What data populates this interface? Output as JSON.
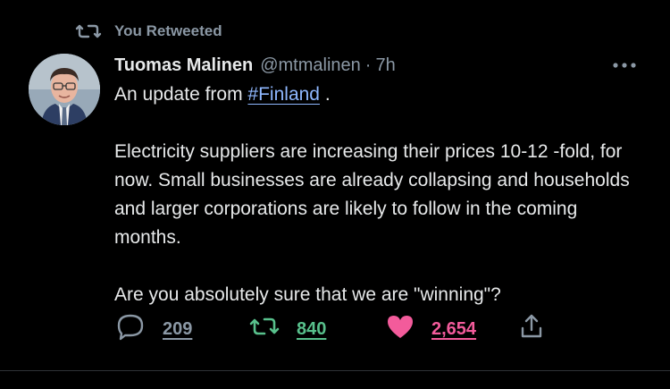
{
  "banner": {
    "text": "You Retweeted",
    "icon": "retweet-icon"
  },
  "author": {
    "display_name": "Tuomas Malinen",
    "handle": "@mtmalinen",
    "separator": "·",
    "time": "7h",
    "avatar_icon": "avatar-photo"
  },
  "menu": {
    "icon": "more-options-icon"
  },
  "tweet": {
    "line1_prefix": "An update from ",
    "hashtag": "#Finland",
    "line1_suffix": " .",
    "paragraph2": "Electricity suppliers are increasing their prices 10-12 -fold, for now. Small businesses are already collapsing and households and larger corporations are likely to follow in the coming months.",
    "paragraph3": "Are you absolutely sure that we are \"winning\"?"
  },
  "actions": {
    "reply_count": "209",
    "retweet_count": "840",
    "like_count": "2,654",
    "reply_icon": "reply-icon",
    "retweet_icon": "retweet-icon",
    "like_icon": "heart-icon",
    "share_icon": "share-icon"
  },
  "colors": {
    "background": "#000000",
    "text": "#e7e9ea",
    "muted": "#8b98a5",
    "hashtag": "#8fb8ff",
    "retweet": "#58c08c",
    "like": "#f35b9b"
  }
}
